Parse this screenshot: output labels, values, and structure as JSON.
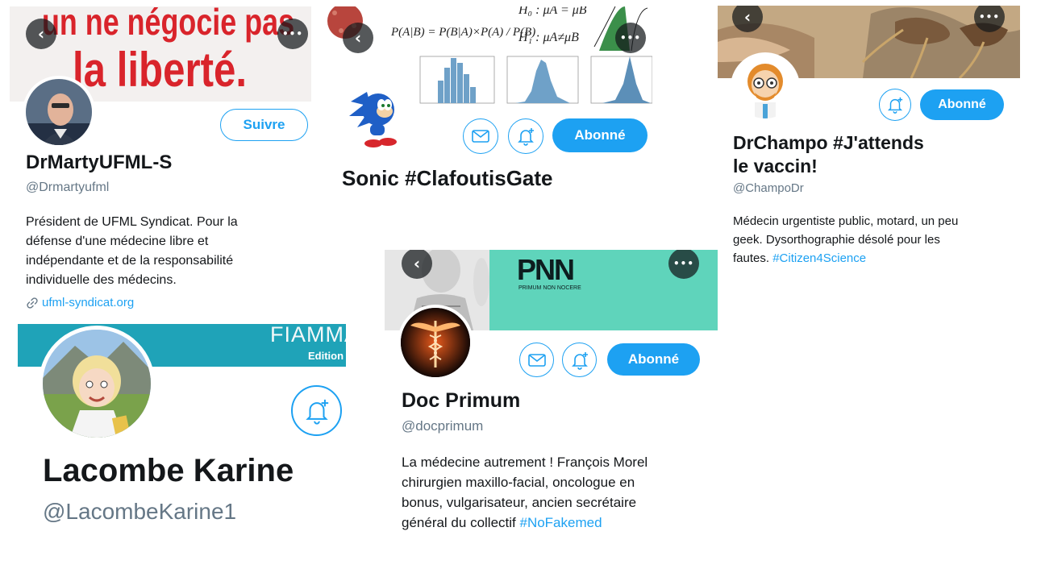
{
  "colors": {
    "accent": "#1da1f2",
    "text": "#14171a",
    "muted": "#657786"
  },
  "icons": {
    "back": "chevron-left-icon",
    "more": "more-horizontal-icon",
    "message": "envelope-icon",
    "notify": "bell-plus-icon",
    "link": "link-icon"
  },
  "glyphs": {
    "back": "‹",
    "more": "•••"
  },
  "profiles": {
    "marty": {
      "banner_text_line1": "un ne négocie pas",
      "banner_text_line2": "la liberté.",
      "follow_label": "Suivre",
      "name": "DrMartyUFML-S",
      "handle": "@Drmartyufml",
      "bio_lines": [
        "Président de UFML Syndicat. Pour la",
        "défense d'une médecine libre et",
        "indépendante et de la responsabilité",
        "individuelle des médecins."
      ],
      "link": "ufml-syndicat.org"
    },
    "sonic": {
      "formula": "P(A|B) = P(B|A)×P(A) / P(B)",
      "h0": "H₀ : μA = μB",
      "h1": "H₁ : μA≠μB",
      "follow_label": "Abonné",
      "name": "Sonic #ClafoutisGate"
    },
    "champo": {
      "follow_label": "Abonné",
      "name_line1": "DrChampo #J'attends",
      "name_line2": "le vaccin!",
      "handle": "@ChampoDr",
      "bio_line1": "Médecin urgentiste public, motard, un peu",
      "bio_line2": "geek. Dysorthographie désolé pour les",
      "bio_line3_text": "fautes. ",
      "bio_line3_tag": "#Citizen4Science"
    },
    "lacombe": {
      "banner_text": "FIAMMA",
      "banner_subtext": "Edition",
      "name": "Lacombe Karine",
      "handle": "@LacombeKarine1"
    },
    "primum": {
      "banner_logo": "PNN",
      "banner_logo_sub": "PRIMUM NON NOCERE",
      "follow_label": "Abonné",
      "name": "Doc Primum",
      "handle": "@docprimum",
      "bio_line1": "La médecine autrement ! François Morel",
      "bio_line2": "chirurgien maxillo-facial, oncologue en",
      "bio_line3": "bonus, vulgarisateur, ancien secrétaire",
      "bio_line4_text": "général du collectif ",
      "bio_line4_tag": "#NoFakemed"
    }
  }
}
